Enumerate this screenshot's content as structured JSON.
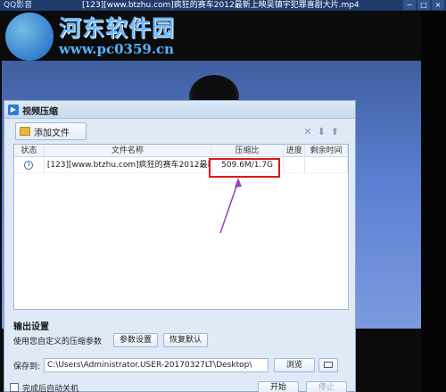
{
  "player": {
    "app_name": "QQ影音",
    "window_title": "[123][www.btzhu.com]疯狂的赛车2012最新上映吴镇宇犯罪喜剧大片.mp4",
    "controls": [
      "−",
      "□",
      "×"
    ]
  },
  "watermark": {
    "site_name": "河东软件园",
    "url": "www.pc0359.cn"
  },
  "dialog": {
    "title": "视频压缩",
    "add_file_label": "添加文件",
    "tool_icons": [
      "close-icon",
      "arrow-down-icon",
      "arrow-up-icon"
    ],
    "table": {
      "columns": [
        "状态",
        "文件名称",
        "压缩比",
        "进度",
        "剩余时间"
      ],
      "rows": [
        {
          "status_icon": "clock-icon",
          "name": "[123][www.btzhu.com]疯狂的赛车2012最新上...",
          "ratio": "509.6M/1.7G",
          "progress": "",
          "remaining": ""
        }
      ]
    },
    "output": {
      "title": "输出设置",
      "params_text": "使用您自定义的压缩参数",
      "param_settings_label": "参数设置",
      "restore_default_label": "恢复默认",
      "save_label": "保存到:",
      "save_path": "C:\\Users\\Administrator.USER-20170327LT\\Desktop\\",
      "browse_label": "浏览"
    },
    "bottom": {
      "shutdown_label": "完成后自动关机",
      "start_label": "开始",
      "stop_label": "停止"
    }
  },
  "colors": {
    "highlight": "#e01818",
    "annotation_arrow": "#9b3fb5",
    "dialog_bg": "#dfeaf6"
  }
}
